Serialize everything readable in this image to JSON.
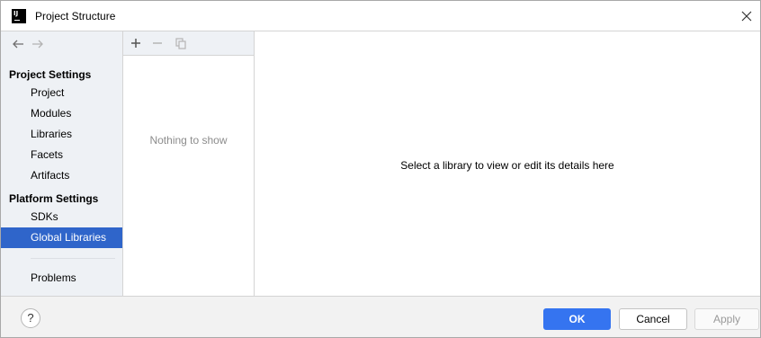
{
  "window": {
    "title": "Project Structure",
    "app_icon": "intellij-icon",
    "app_icon_text": "IJ",
    "close_icon": "close-icon"
  },
  "sidebar": {
    "back_icon": "arrow-left-icon",
    "forward_icon": "arrow-right-icon",
    "project_settings_title": "Project Settings",
    "project_items": [
      {
        "label": "Project"
      },
      {
        "label": "Modules"
      },
      {
        "label": "Libraries"
      },
      {
        "label": "Facets"
      },
      {
        "label": "Artifacts"
      }
    ],
    "platform_settings_title": "Platform Settings",
    "platform_items": [
      {
        "label": "SDKs"
      },
      {
        "label": "Global Libraries",
        "selected": true
      }
    ],
    "problems_label": "Problems",
    "selection_color": "#2f65ca"
  },
  "list_panel": {
    "add_icon": "plus-icon",
    "remove_icon": "minus-icon",
    "copy_icon": "copy-icon",
    "empty_text": "Nothing to show"
  },
  "detail": {
    "hint": "Select a library to view or edit its details here"
  },
  "footer": {
    "help_label": "?",
    "ok_label": "OK",
    "cancel_label": "Cancel",
    "apply_label": "Apply",
    "accent_color": "#3574f0"
  }
}
